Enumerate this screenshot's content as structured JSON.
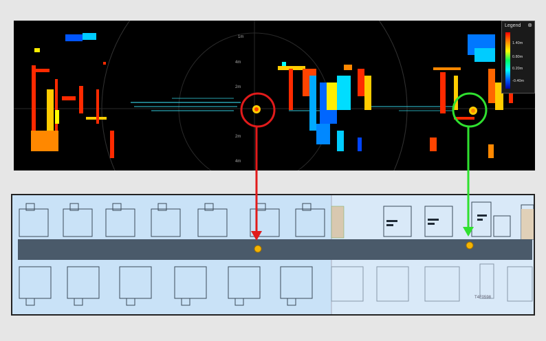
{
  "lidar_view": {
    "range_labels": [
      "1m",
      "4m",
      "2m",
      "2m",
      "4m"
    ],
    "legend": {
      "title": "Legend",
      "close_icon": "close-icon",
      "labels": [
        "1.40m",
        "0.80m",
        "0.20m",
        "-0.40m"
      ]
    }
  },
  "markers": {
    "red": "#e11b1b",
    "green": "#2fe02f",
    "point_fill": "#f5b400"
  },
  "floor_plan": {
    "corridor_color": "#4a5a6a",
    "labels": [
      "T4F0598"
    ]
  }
}
